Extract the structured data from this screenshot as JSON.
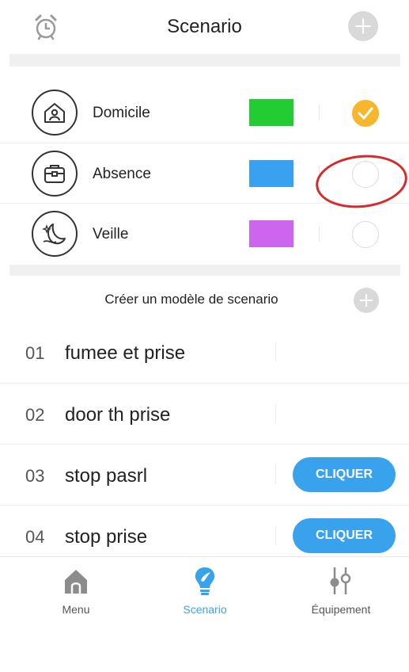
{
  "header": {
    "title": "Scenario",
    "left_icon": "alarm-clock-icon",
    "right_icon": "plus-icon"
  },
  "scenes": [
    {
      "label": "Domicile",
      "icon": "house-person-icon",
      "color": "#22cc33",
      "selected": true
    },
    {
      "label": "Absence",
      "icon": "briefcase-icon",
      "color": "#3aa0f0",
      "selected": false
    },
    {
      "label": "Veille",
      "icon": "moon-stars-icon",
      "color": "#cc66ee",
      "selected": false
    }
  ],
  "create": {
    "label": "Créer un modèle de scenario",
    "icon": "plus-icon"
  },
  "models": [
    {
      "number": "01",
      "name": "fumee et prise",
      "button": ""
    },
    {
      "number": "02",
      "name": "door th prise",
      "button": ""
    },
    {
      "number": "03",
      "name": "stop pasrl",
      "button": "CLIQUER"
    },
    {
      "number": "04",
      "name": "stop prise",
      "button": "CLIQUER"
    }
  ],
  "tabs": [
    {
      "label": "Menu",
      "icon": "home-icon",
      "active": false
    },
    {
      "label": "Scenario",
      "icon": "lightbulb-icon",
      "active": true
    },
    {
      "label": "Équipement",
      "icon": "sliders-icon",
      "active": false
    }
  ],
  "colors": {
    "accent": "#39a2ec",
    "check": "#f6b72f",
    "annotation": "#d42b2b",
    "inactive_icon": "#8c8c8c"
  }
}
